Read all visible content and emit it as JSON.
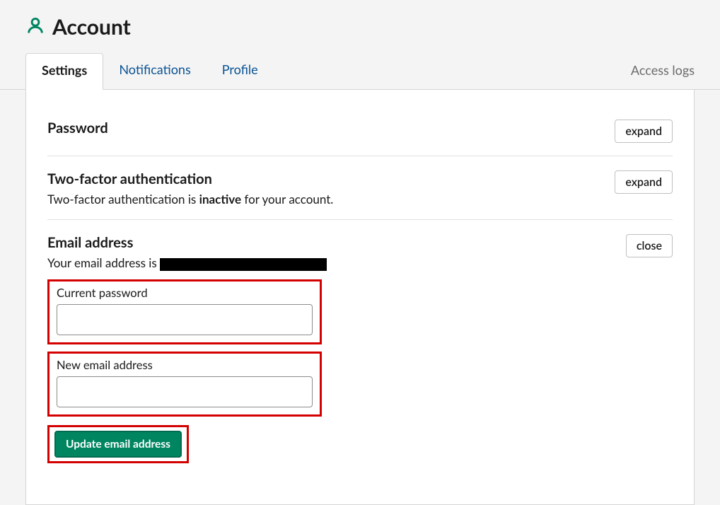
{
  "header": {
    "title": "Account"
  },
  "tabs": {
    "settings": "Settings",
    "notifications": "Notifications",
    "profile": "Profile",
    "access_logs": "Access logs"
  },
  "sections": {
    "password": {
      "title": "Password",
      "toggle": "expand"
    },
    "twofa": {
      "title": "Two-factor authentication",
      "sub_pre": "Two-factor authentication is ",
      "sub_strong": "inactive",
      "sub_post": " for your account.",
      "toggle": "expand"
    },
    "email": {
      "title": "Email address",
      "sub_pre": "Your email address is ",
      "redacted_value": "",
      "toggle": "close",
      "current_password_label": "Current password",
      "current_password_value": "",
      "new_email_label": "New email address",
      "new_email_value": "",
      "submit_label": "Update email address"
    }
  }
}
